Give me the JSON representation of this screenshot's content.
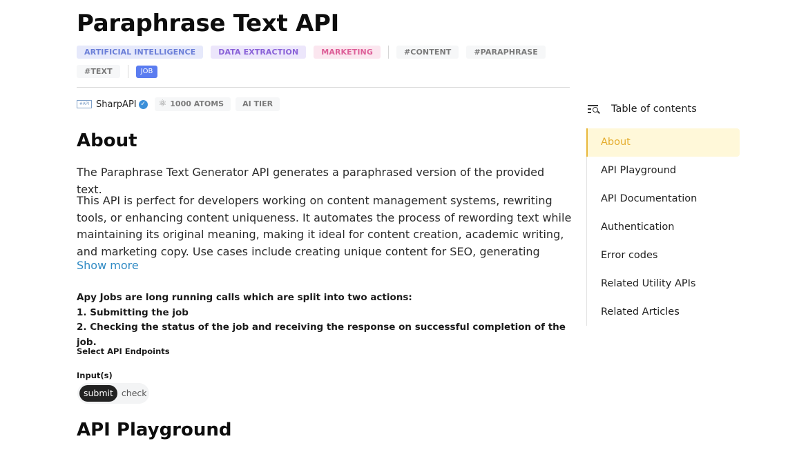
{
  "page": {
    "title": "Paraphrase Text API"
  },
  "tags": {
    "categories": [
      "ARTIFICIAL INTELLIGENCE",
      "DATA EXTRACTION",
      "MARKETING"
    ],
    "hashtags": [
      "#CONTENT",
      "#PARAPHRASE",
      "#TEXT"
    ],
    "type_badge": "JOB"
  },
  "meta": {
    "provider_logo_text": "#API",
    "provider_name": "SharpAPI",
    "verified_icon": "check-badge-icon",
    "atoms_label": "1000 ATOMS",
    "atoms_icon": "atom-icon",
    "tier_label": "AI TIER"
  },
  "about": {
    "heading": "About",
    "summary": "The Paraphrase Text Generator API generates a paraphrased version of the provided text.",
    "description": "This API is perfect for developers working on content management systems, rewriting tools, or enhancing content uniqueness. It automates the process of rewording text while maintaining its original meaning, making it ideal for content creation, academic writing, and marketing copy. Use cases include creating unique content for SEO, generating alternative text versions, and",
    "show_more": "Show more",
    "jobs_intro": "Apy Jobs are long running calls which are split into two actions:",
    "jobs_steps": [
      "1. Submitting the job",
      "2. Checking the status of the job and receiving the response on successful completion of the job."
    ],
    "select_endpoints_label": "Select API Endpoints",
    "inputs_label": "Input(s)",
    "endpoints": [
      {
        "label": "submit",
        "active": true
      },
      {
        "label": "check",
        "active": false
      }
    ]
  },
  "playground": {
    "heading": "API Playground"
  },
  "toc": {
    "title": "Table of contents",
    "icon": "toc-search-icon",
    "items": [
      {
        "label": "About",
        "active": true
      },
      {
        "label": "API Playground",
        "active": false
      },
      {
        "label": "API Documentation",
        "active": false
      },
      {
        "label": "Authentication",
        "active": false
      },
      {
        "label": "Error codes",
        "active": false
      },
      {
        "label": "Related Utility APIs",
        "active": false
      },
      {
        "label": "Related Articles",
        "active": false
      }
    ]
  },
  "colors": {
    "accent_toc_active": "#e5ad2e",
    "link": "#2f8ac4",
    "job_badge": "#5a7cf0"
  }
}
